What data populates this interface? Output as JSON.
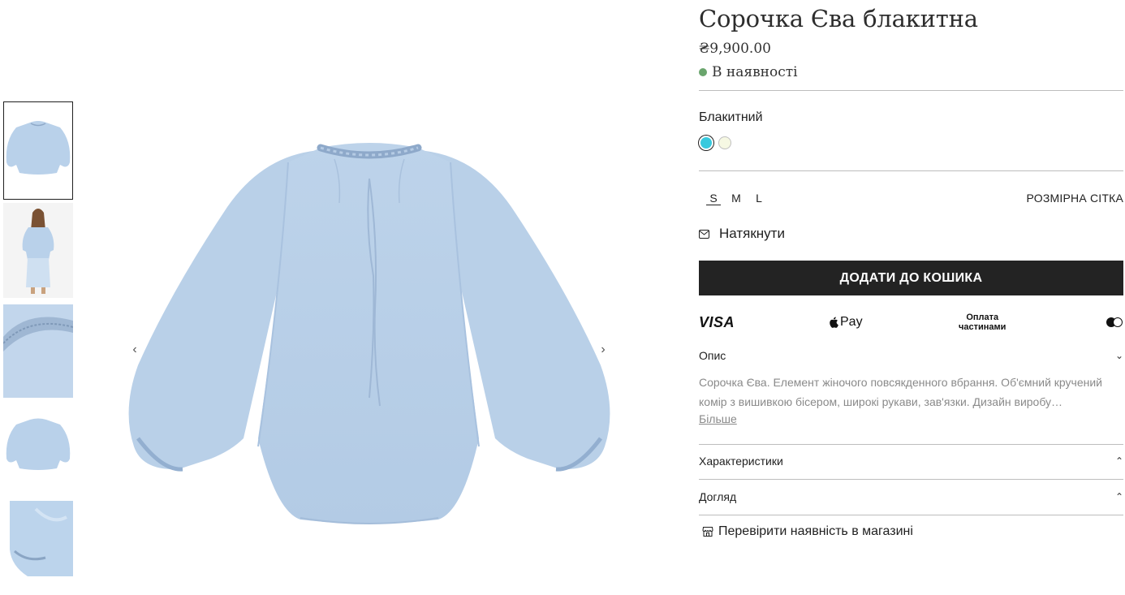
{
  "product": {
    "title": "Сорочка Єва блакитна",
    "price": "₴9,900.00",
    "stock_status": "В наявності",
    "stock_color": "#6aa56d"
  },
  "gallery": {
    "thumbnails": [
      {
        "name": "thumb-blouse-front",
        "active": true
      },
      {
        "name": "thumb-model-full",
        "active": false
      },
      {
        "name": "thumb-collar-detail",
        "active": false
      },
      {
        "name": "thumb-blouse-back",
        "active": false
      },
      {
        "name": "thumb-sleeve-detail",
        "active": false
      }
    ],
    "prev_icon": "chevron-left-icon",
    "next_icon": "chevron-right-icon",
    "prev_glyph": "‹",
    "next_glyph": "›"
  },
  "variant": {
    "color_label": "Блакитний",
    "swatches": [
      {
        "name": "swatch-blue",
        "color": "#38c9de",
        "selected": true
      },
      {
        "name": "swatch-cream",
        "color": "#f6f8e3",
        "selected": false
      }
    ]
  },
  "sizes": {
    "options": [
      "S",
      "M",
      "L"
    ],
    "selected": "S",
    "guide_label": "РОЗМІРНА СІТКА"
  },
  "notify": {
    "label": "Натякнути",
    "icon": "envelope-icon"
  },
  "cart": {
    "add_label": "ДОДАТИ ДО КОШИКА"
  },
  "payments": {
    "visa": "VISA",
    "apple_pay": "Pay",
    "installments": [
      "Оплата",
      "частинами"
    ],
    "mastercard_icon": "mastercard-icon"
  },
  "accordion": {
    "description_title": "Опис",
    "description_text": "Сорочка Єва. Елемент жіночого повсякденного вбрання. Об'ємний кручений комір з вишивкою бісером, широкі рукави, зав'язки. Дизайн виробу…",
    "more_label": "Більше",
    "specs_title": "Характеристики",
    "care_title": "Догляд"
  },
  "store": {
    "check_label": "Перевірити наявність в магазині",
    "icon": "store-icon"
  }
}
